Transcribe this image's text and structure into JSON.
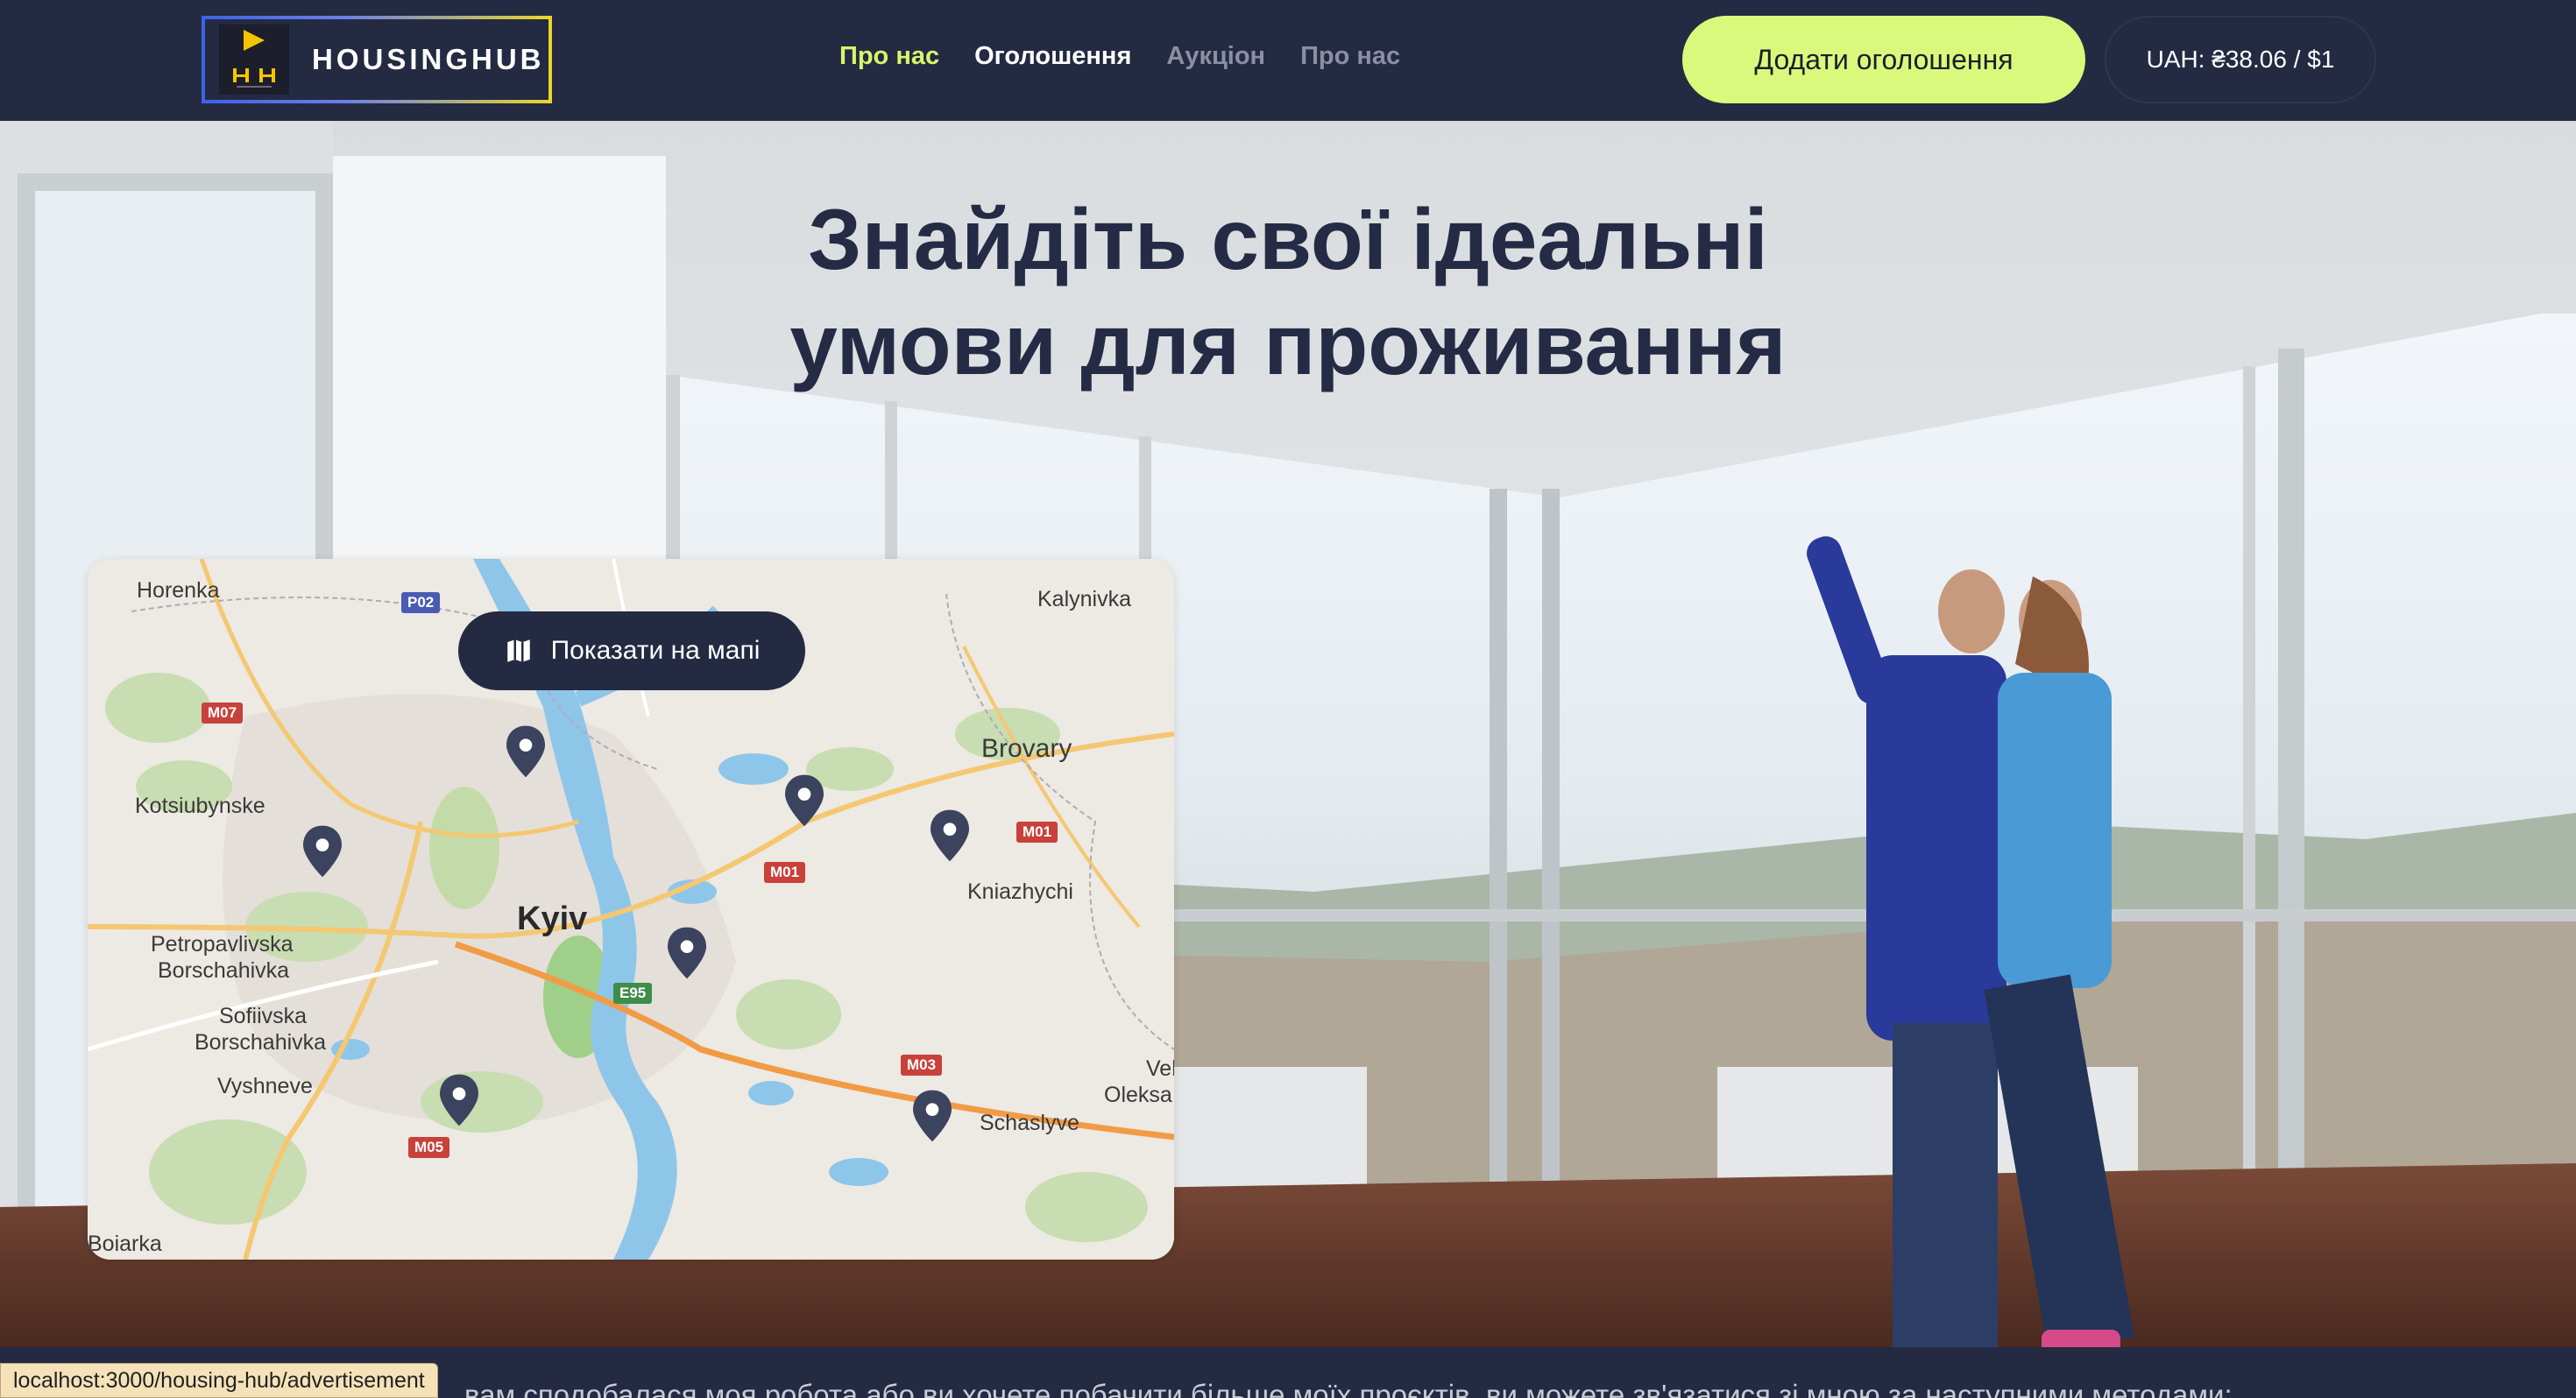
{
  "header": {
    "logo_text": "HOUSINGHUB",
    "logo_mark_letters": "H H",
    "nav": [
      {
        "label": "Про нас",
        "state": "active"
      },
      {
        "label": "Оголошення",
        "state": "normal"
      },
      {
        "label": "Аукціон",
        "state": "dim"
      },
      {
        "label": "Про нас",
        "state": "dim"
      }
    ],
    "add_button": "Додати оголошення",
    "currency_rate": "UAH: ₴38.06 / $1"
  },
  "hero": {
    "title_line1": "Знайдіть свої ідеальні",
    "title_line2": "умови для проживання"
  },
  "map": {
    "show_map_button": "Показати на мапі",
    "icon": "map-icon",
    "places": {
      "horenka": "Horenka",
      "kalynivka": "Kalynivka",
      "brovary": "Brovary",
      "kotsiubynske": "Kotsiubynske",
      "kniazhychi": "Kniazhychi",
      "kyiv": "Kyiv",
      "petropavlivska1": "Petropavlivska",
      "petropavlivska2": "Borschahivka",
      "sofiivska1": "Sofiivska",
      "sofiivska2": "Borschahivka",
      "vyshneve": "Vyshneve",
      "vel": "Vel",
      "oleksa": "Oleksa",
      "schaslyve": "Schaslyve",
      "boiarka": "Boiarka"
    },
    "roads": {
      "p02": "P02",
      "m07": "M07",
      "m01a": "M01",
      "m01b": "M01",
      "e95": "E95",
      "m03": "M03",
      "m05": "M05"
    },
    "pin_count": 7
  },
  "footer": {
    "text": "вам сподобалася моя робота або ви хочете побачити більше моїх проєктів, ви можете зв'язатися зі мною за наступними методами:"
  },
  "status_url": "localhost:3000/housing-hub/advertisement",
  "colors": {
    "nav_bg": "#242a42",
    "accent": "#daf97c",
    "active_link": "#d8f56a",
    "title": "#252b45"
  }
}
